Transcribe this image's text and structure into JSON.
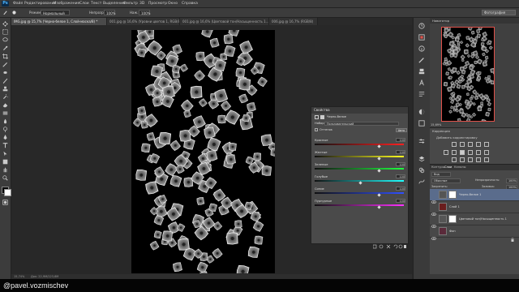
{
  "app": {
    "logo": "Ps"
  },
  "menu": [
    "Файл",
    "Редактирование",
    "Изображение",
    "Слои",
    "Текст",
    "Выделение",
    "Фильтр",
    "3D",
    "Просмотр",
    "Окно",
    "Справка"
  ],
  "options": {
    "mode_label": "Режим:",
    "mode_value": "Нормальный",
    "opacity_label": "Непрозр.:",
    "opacity_value": "100%",
    "flow_label": "Наж.:",
    "flow_value": "100%",
    "workspace": "Фотография"
  },
  "tabs": [
    {
      "label": "IMG.jpg @ 15,7% (Черно-белое 1, Слой-маска/8) *",
      "active": true
    },
    {
      "label": "001.jpg @ 16,6% (Уровни цветов 1, RGB/8)",
      "active": false
    },
    {
      "label": "001.jpg @ 16,6% (Цветовой тон/Насыщенность 1...)",
      "active": false
    },
    {
      "label": "006.jpg @ 16,7% (RGB/8)",
      "active": false
    }
  ],
  "status": {
    "zoom": "15,74%",
    "doc_info": "Док: 22,9M/123,6M"
  },
  "properties": {
    "title": "Свойства",
    "adjustment_name": "Черно-белое",
    "preset_label": "Набор:",
    "preset_value": "Пользовательский",
    "tint_label": "Оттенок",
    "auto_label": "Авто",
    "sliders": [
      {
        "label": "Красные",
        "value": "100",
        "pos": 0.72
      },
      {
        "label": "Желтые",
        "value": "100",
        "pos": 0.72
      },
      {
        "label": "Зеленые",
        "value": "100",
        "pos": 0.72
      },
      {
        "label": "Голубые",
        "value": "100",
        "pos": 0.51
      },
      {
        "label": "Синие",
        "value": "100",
        "pos": 0.72
      },
      {
        "label": "Пурпурные",
        "value": "100",
        "pos": 0.72
      }
    ]
  },
  "navigator": {
    "title": "Навигатор",
    "zoom": "15,69%"
  },
  "adjustments": {
    "title": "Коррекция",
    "subtitle": "Добавить корректировку"
  },
  "layers_panel": {
    "tabs": [
      "Контуры",
      "Слои",
      "Каналы"
    ],
    "kind_label": "Вид",
    "blend": "Обычные",
    "opacity_label": "Непрозрачность:",
    "opacity": "100%",
    "lock_label": "Закрепить:",
    "fill_label": "Заливка:",
    "fill": "100%",
    "layers": [
      {
        "name": "Черно-белое 1",
        "selected": true
      },
      {
        "name": "Слой 1",
        "selected": false
      },
      {
        "name": "Цветовой тон/Насыщенность 1",
        "selected": false
      },
      {
        "name": "Фон",
        "selected": false
      }
    ]
  },
  "watermark": "@pavel.vozmischev",
  "colors": {
    "accent_red": "#e0514a",
    "selection": "#5a6c8c",
    "ps_blue": "#4fb6ff"
  }
}
